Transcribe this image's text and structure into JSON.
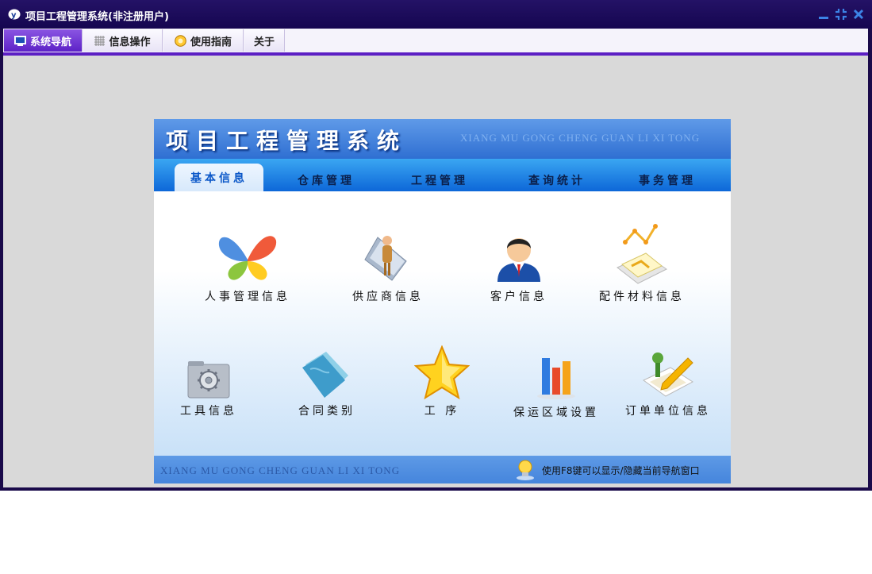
{
  "window": {
    "title": "项目工程管理系统(非注册用户)"
  },
  "menubar": {
    "items": [
      {
        "label": "系统导航",
        "icon": "monitor-icon",
        "active": true
      },
      {
        "label": "信息操作",
        "icon": "grid-icon",
        "active": false
      },
      {
        "label": "使用指南",
        "icon": "guide-icon",
        "active": false
      },
      {
        "label": "关于",
        "icon": "",
        "active": false
      }
    ]
  },
  "panel": {
    "banner_title": "项目工程管理系统",
    "banner_subtitle": "XIANG MU GONG CHENG GUAN LI XI TONG",
    "tabs": [
      {
        "label": "基本信息",
        "active": true
      },
      {
        "label": "仓库管理",
        "active": false
      },
      {
        "label": "工程管理",
        "active": false
      },
      {
        "label": "查询统计",
        "active": false
      },
      {
        "label": "事务管理",
        "active": false
      }
    ],
    "items": [
      {
        "label": "人事管理信息",
        "icon": "butterfly-icon"
      },
      {
        "label": "供应商信息",
        "icon": "person-document-icon"
      },
      {
        "label": "客户信息",
        "icon": "user-icon"
      },
      {
        "label": "配件材料信息",
        "icon": "chart-paper-icon"
      },
      {
        "label": "工具信息",
        "icon": "gear-folder-icon"
      },
      {
        "label": "合同类别",
        "icon": "folder-icon"
      },
      {
        "label": "工    序",
        "icon": "star-icon"
      },
      {
        "label": "保运区域设置",
        "icon": "bar-chart-icon"
      },
      {
        "label": "订单单位信息",
        "icon": "pencil-paper-icon"
      }
    ],
    "footer_subtitle": "XIANG MU GONG CHENG GUAN LI XI TONG",
    "footer_tip": "使用F8键可以显示/隐藏当前导航窗口"
  },
  "colors": {
    "titlebar": "#1a0a4a",
    "menu_accent": "#5c1fc4",
    "banner": "#2f6fd2",
    "tab_active_text": "#0a57c8"
  }
}
